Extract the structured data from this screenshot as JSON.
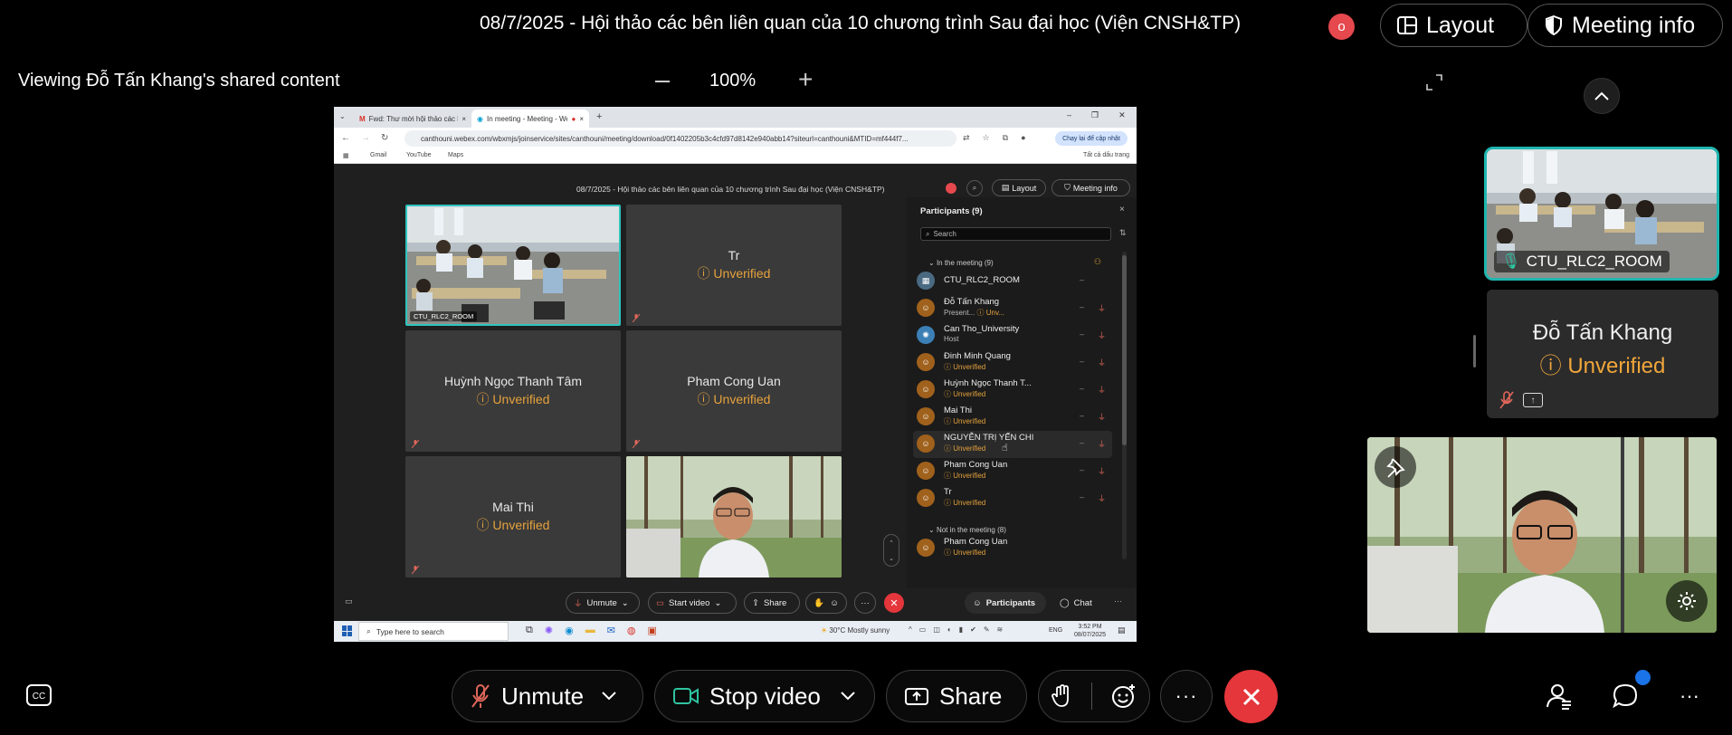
{
  "header": {
    "title": "08/7/2025 - Hội thảo các bên liên quan của 10 chương trình Sau đại học (Viện CNSH&TP)",
    "record_indicator": "o",
    "layout_label": "Layout",
    "meeting_info_label": "Meeting info"
  },
  "viewing": {
    "label": "Viewing Đỗ Tấn Khang's shared content",
    "zoom": "100%",
    "zoom_out": "—",
    "zoom_in": "+"
  },
  "shared": {
    "tabs": [
      {
        "label": "Fwd: Thư mời hội thảo các bên"
      },
      {
        "label": "In meeting - Meeting - Webe"
      }
    ],
    "url": "canthouni.webex.com/wbxmjs/joinservice/sites/canthouni/meeting/download/0f1402205b3c4cfd97d8142e940abb14?siteurl=canthouni&MTID=mf444f7...",
    "update_btn": "Chạy lại để cập nhật",
    "bookmarks": [
      "Gmail",
      "YouTube",
      "Maps"
    ],
    "all_bookmarks": "Tất cả dấu trang",
    "meeting_title": "08/7/2025 - Hội thảo các bên liên quan của 10 chương trình Sau đại học (Viện CNSH&TP)",
    "layout_label": "Layout",
    "meeting_info_label": "Meeting info",
    "tiles": [
      {
        "name": "CTU_RLC2_ROOM"
      },
      {
        "name": "Tr",
        "status": "Unverified"
      },
      {
        "name": "Huỳnh Ngọc Thanh Tâm",
        "status": "Unverified"
      },
      {
        "name": "Pham Cong Uan",
        "status": "Unverified"
      },
      {
        "name": "Mai Thi",
        "status": "Unverified"
      }
    ],
    "panel": {
      "title": "Participants (9)",
      "search_placeholder": "Search",
      "in_meeting": "In the meeting (9)",
      "not_in_meeting": "Not in the meeting (8)",
      "rows": [
        {
          "name": "CTU_RLC2_ROOM",
          "sub": ""
        },
        {
          "name": "Đỗ Tấn Khang",
          "sub": "Present...",
          "sub2": "Unv..."
        },
        {
          "name": "Can Tho_University",
          "sub": "Host"
        },
        {
          "name": "Đinh Minh Quang",
          "sub": "Unverified"
        },
        {
          "name": "Huỳnh Ngọc Thanh T...",
          "sub": "Unverified"
        },
        {
          "name": "Mai Thi",
          "sub": "Unverified"
        },
        {
          "name": "NGUYỄN TRỊ YẾN CHI",
          "sub": "Unverified"
        },
        {
          "name": "Pham Cong Uan",
          "sub": "Unverified"
        },
        {
          "name": "Tr",
          "sub": "Unverified"
        }
      ],
      "not_rows": [
        {
          "name": "Pham Cong Uan",
          "sub": "Unverified"
        }
      ]
    },
    "controls": {
      "unmute": "Unmute",
      "start_video": "Start video",
      "share": "Share",
      "participants": "Participants",
      "chat": "Chat"
    },
    "taskbar": {
      "search": "Type here to search",
      "weather": "30°C  Mostly sunny",
      "lang": "ENG",
      "time": "3:52 PM",
      "date": "08/07/2025"
    }
  },
  "side": {
    "room_label": "CTU_RLC2_ROOM",
    "presenter_name": "Đỗ Tấn Khang",
    "presenter_status": "Unverified"
  },
  "controls": {
    "unmute": "Unmute",
    "stop_video": "Stop video",
    "share": "Share"
  },
  "colors": {
    "accent_teal": "#1fb6b0",
    "unverified": "#f0a63a",
    "end_red": "#e5363b",
    "rec_red": "#e5484d",
    "notif_blue": "#1a73e8"
  }
}
